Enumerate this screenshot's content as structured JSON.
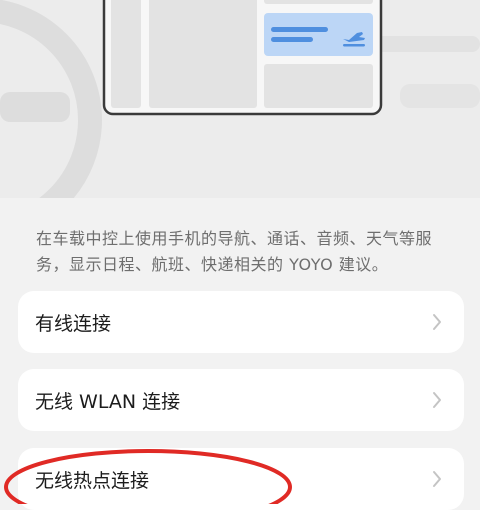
{
  "description": "在车载中控上使用手机的导航、通话、音频、天气等服务，显示日程、航班、快递相关的 YOYO 建议。",
  "options": [
    {
      "label": "有线连接"
    },
    {
      "label": "无线 WLAN 连接"
    },
    {
      "label": "无线热点连接"
    }
  ],
  "icons": {
    "chevron": "chevron-right-icon",
    "flight": "airplane-icon"
  },
  "colors": {
    "background": "#f2f2f2",
    "card": "#ffffff",
    "accent_blue": "#4f8fdf",
    "annotation_red": "#e02a25"
  }
}
